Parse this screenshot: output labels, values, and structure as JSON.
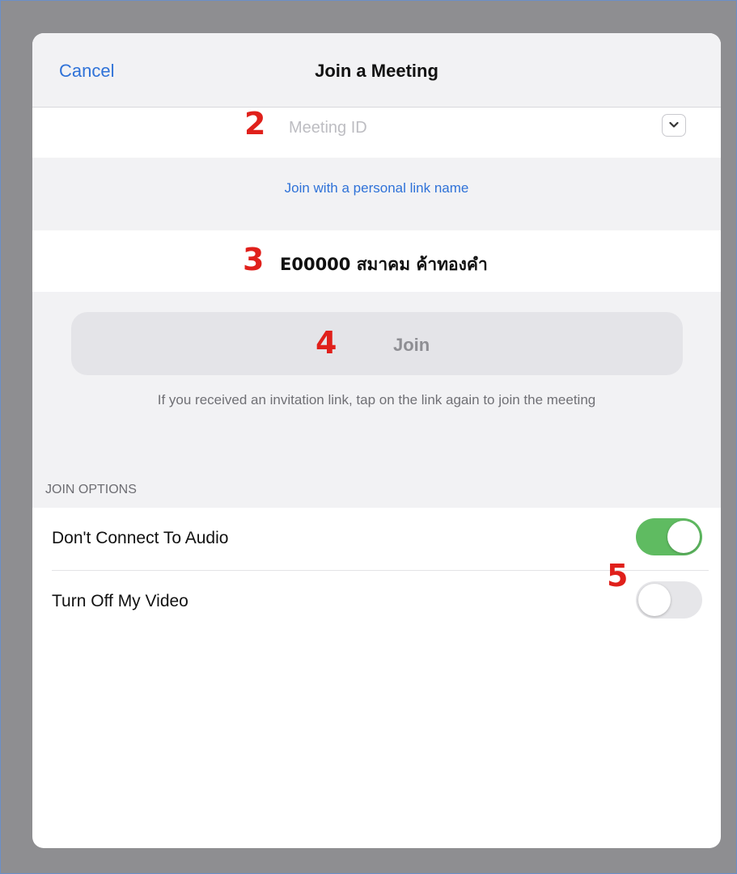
{
  "navbar": {
    "cancel_label": "Cancel",
    "title": "Join a Meeting"
  },
  "meeting": {
    "placeholder": "Meeting ID",
    "value": ""
  },
  "personal_link": {
    "label": "Join with a personal link name"
  },
  "display_name": "E00000 สมาคม ค้าทองคำ",
  "join": {
    "label": "Join",
    "hint": "If you received an invitation link, tap on the link again to join the meeting"
  },
  "join_options": {
    "header": "JOIN OPTIONS",
    "items": [
      {
        "label": "Don't Connect To Audio",
        "enabled": true
      },
      {
        "label": "Turn Off My Video",
        "enabled": false
      }
    ]
  },
  "step_markers": [
    "2",
    "3",
    "4",
    "5"
  ],
  "colors": {
    "accent": "#2f72d8",
    "toggle_on": "#5fbb61",
    "marker": "#e0201b"
  },
  "icons": {
    "dropdown": "chevron-down-icon"
  }
}
